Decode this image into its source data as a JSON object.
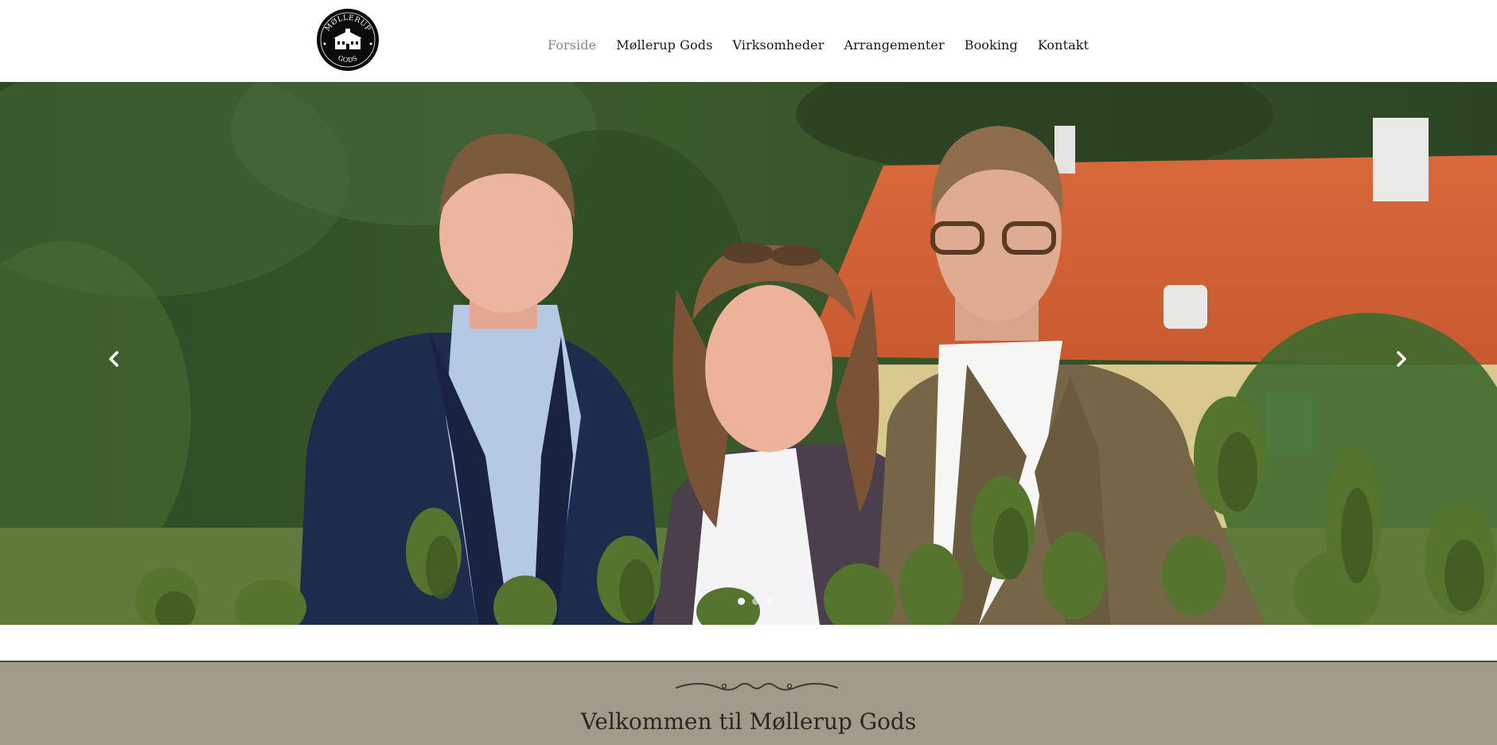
{
  "logo": {
    "top_text": "MØLLERUP",
    "bottom_text": "GODS"
  },
  "nav": {
    "items": [
      {
        "label": "Forside",
        "active": true
      },
      {
        "label": "Møllerup Gods",
        "active": false
      },
      {
        "label": "Virksomheder",
        "active": false
      },
      {
        "label": "Arrangementer",
        "active": false
      },
      {
        "label": "Booking",
        "active": false
      },
      {
        "label": "Kontakt",
        "active": false
      }
    ]
  },
  "hero": {
    "icons": {
      "prev": "chevron-left-icon",
      "next": "chevron-right-icon"
    },
    "slides_count": 3,
    "active_slide": 1
  },
  "welcome": {
    "title": "Velkommen til Møllerup Gods",
    "background": "#a39b8a"
  }
}
